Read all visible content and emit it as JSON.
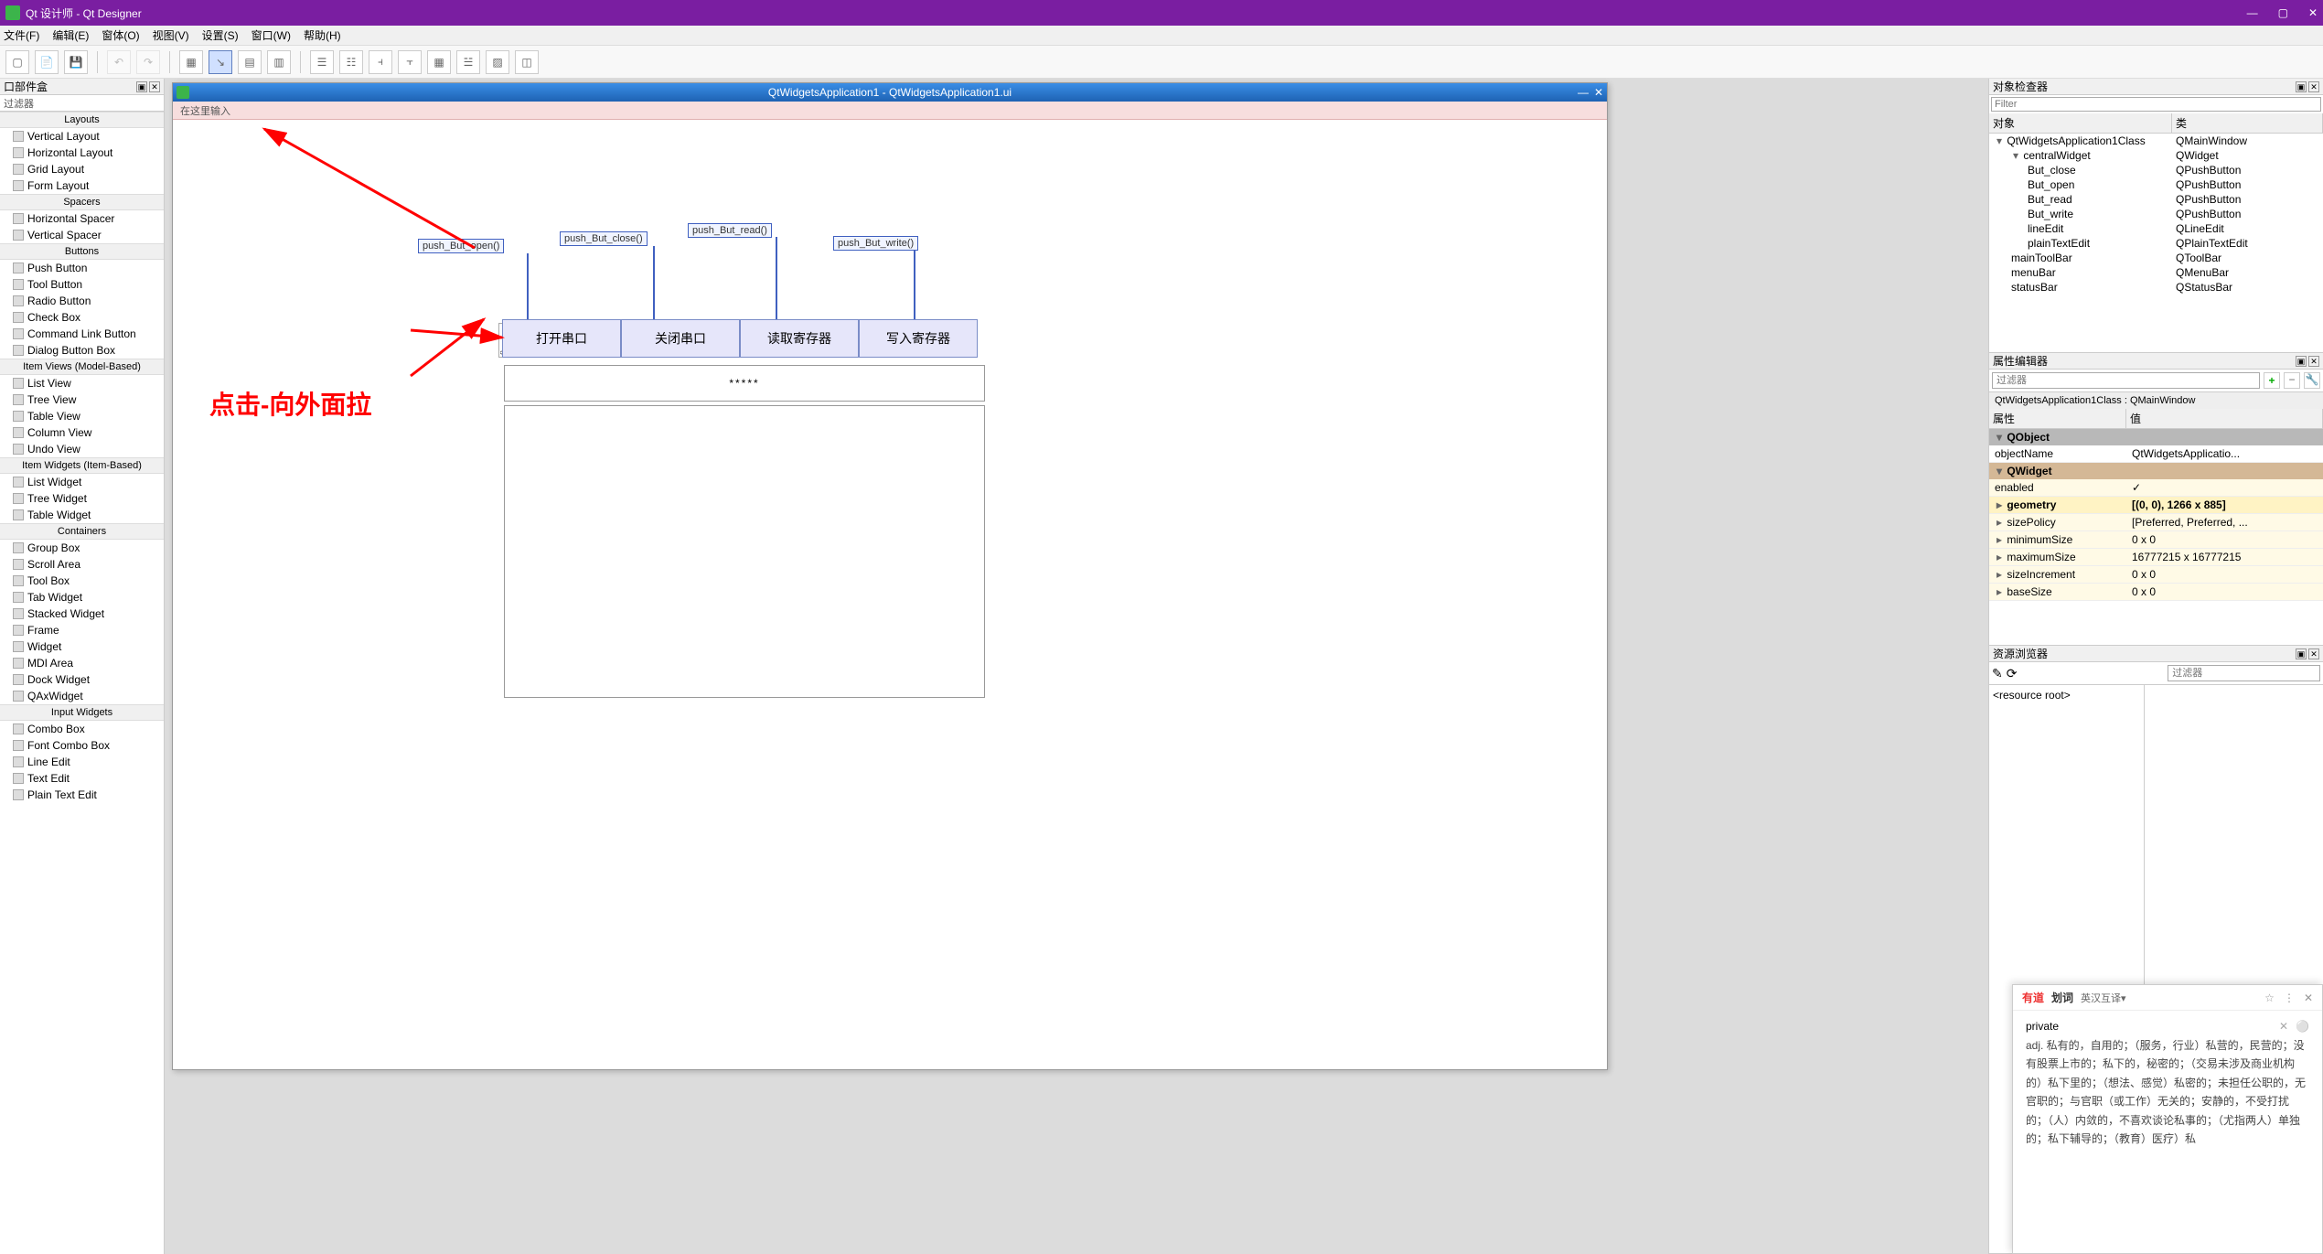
{
  "titlebar": {
    "title": "Qt 设计师 - Qt Designer",
    "min": "—",
    "max": "▢",
    "close": "✕"
  },
  "menus": [
    "文件(F)",
    "编辑(E)",
    "窗体(O)",
    "视图(V)",
    "设置(S)",
    "窗口(W)",
    "帮助(H)"
  ],
  "widgetbox": {
    "title": "口部件盒",
    "filter_label": "过滤器",
    "cats": {
      "layouts": {
        "label": "Layouts",
        "items": [
          "Vertical Layout",
          "Horizontal Layout",
          "Grid Layout",
          "Form Layout"
        ]
      },
      "spacers": {
        "label": "Spacers",
        "items": [
          "Horizontal Spacer",
          "Vertical Spacer"
        ]
      },
      "buttons": {
        "label": "Buttons",
        "items": [
          "Push Button",
          "Tool Button",
          "Radio Button",
          "Check Box",
          "Command Link Button",
          "Dialog Button Box"
        ]
      },
      "itemviews": {
        "label": "Item Views (Model-Based)",
        "items": [
          "List View",
          "Tree View",
          "Table View",
          "Column View",
          "Undo View"
        ]
      },
      "itemwidg": {
        "label": "Item Widgets (Item-Based)",
        "items": [
          "List Widget",
          "Tree Widget",
          "Table Widget"
        ]
      },
      "containers": {
        "label": "Containers",
        "items": [
          "Group Box",
          "Scroll Area",
          "Tool Box",
          "Tab Widget",
          "Stacked Widget",
          "Frame",
          "Widget",
          "MDI Area",
          "Dock Widget",
          "QAxWidget"
        ]
      },
      "inputwidg": {
        "label": "Input Widgets",
        "items": [
          "Combo Box",
          "Font Combo Box",
          "Line Edit",
          "Text Edit",
          "Plain Text Edit"
        ]
      }
    }
  },
  "mdi": {
    "title": "QtWidgetsApplication1 - QtWidgetsApplication1.ui",
    "typehere": "在这里输入",
    "min": "—",
    "close": "✕",
    "buttons": {
      "b1": "打开串口",
      "b2": "关闭串口",
      "b3": "读取寄存器",
      "b4": "写入寄存器"
    },
    "signals": {
      "s1": "push_But_open()",
      "s2": "push_But_close()",
      "s3": "push_But_read()",
      "s4": "push_But_write()",
      "clicked": "clicked()"
    },
    "lineedit": "*****",
    "annotation": "点击-向外面拉"
  },
  "objinsp": {
    "title": "对象检查器",
    "filter_ph": "Filter",
    "hdr_obj": "对象",
    "hdr_cls": "类",
    "rows": [
      {
        "n": "QtWidgetsApplication1Class",
        "c": "QMainWindow",
        "lvl": 0,
        "exp": "▾"
      },
      {
        "n": "centralWidget",
        "c": "QWidget",
        "lvl": 1,
        "exp": "▾"
      },
      {
        "n": "But_close",
        "c": "QPushButton",
        "lvl": 2
      },
      {
        "n": "But_open",
        "c": "QPushButton",
        "lvl": 2
      },
      {
        "n": "But_read",
        "c": "QPushButton",
        "lvl": 2
      },
      {
        "n": "But_write",
        "c": "QPushButton",
        "lvl": 2
      },
      {
        "n": "lineEdit",
        "c": "QLineEdit",
        "lvl": 2
      },
      {
        "n": "plainTextEdit",
        "c": "QPlainTextEdit",
        "lvl": 2
      },
      {
        "n": "mainToolBar",
        "c": "QToolBar",
        "lvl": 1
      },
      {
        "n": "menuBar",
        "c": "QMenuBar",
        "lvl": 1
      },
      {
        "n": "statusBar",
        "c": "QStatusBar",
        "lvl": 1
      }
    ]
  },
  "propedit": {
    "title": "属性编辑器",
    "filter_ph": "过滤器",
    "header": "QtWidgetsApplication1Class : QMainWindow",
    "hdr_prop": "属性",
    "hdr_val": "值",
    "grp_qobj": "QObject",
    "grp_qwid": "QWidget",
    "rows": [
      {
        "n": "objectName",
        "v": "QtWidgetsApplicatio..."
      },
      {
        "n": "enabled",
        "v": "✓",
        "y": 1
      },
      {
        "n": "geometry",
        "v": "[(0, 0), 1266 x 885]",
        "b": 1,
        "y": 1
      },
      {
        "n": "sizePolicy",
        "v": "[Preferred, Preferred, ...",
        "y": 1
      },
      {
        "n": "minimumSize",
        "v": "0 x 0",
        "y": 1
      },
      {
        "n": "maximumSize",
        "v": "16777215 x 16777215",
        "y": 1
      },
      {
        "n": "sizeIncrement",
        "v": "0 x 0",
        "y": 1
      },
      {
        "n": "baseSize",
        "v": "0 x 0",
        "y": 1
      }
    ]
  },
  "resbrowser": {
    "title": "资源浏览器",
    "filter_ph": "过滤器",
    "root": "<resource root>"
  },
  "dict": {
    "brand1": "有道",
    "brand2": "划词",
    "mode": "英汉互译▾",
    "pin": "☆",
    "more": "⋮",
    "close": "✕",
    "word": "private",
    "wx": "✕",
    "wsearch": "⚪",
    "def": "adj. 私有的，自用的；（服务，行业）私营的，民营的；没有股票上市的；私下的，秘密的；（交易未涉及商业机构的）私下里的；（想法、感觉）私密的；未担任公职的，无官职的；与官职（或工作）无关的；安静的，不受打扰的；（人）内敛的，不喜欢谈论私事的；（尤指两人）单独的；私下辅导的；（教育）医疗）私"
  }
}
